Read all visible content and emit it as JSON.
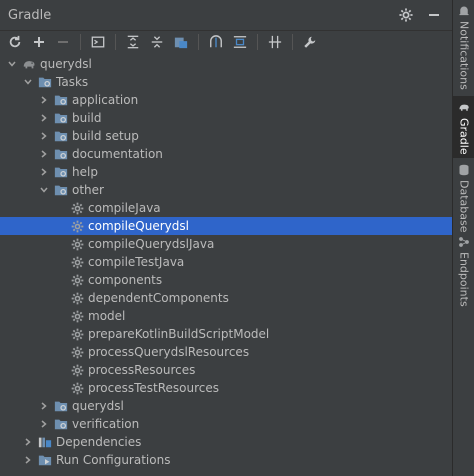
{
  "panel": {
    "title": "Gradle"
  },
  "toolbar": {
    "tools": [
      "reload-icon",
      "add-icon",
      "remove-icon",
      "execute-task-icon",
      "expand-all-icon",
      "collapse-all-icon",
      "dependencies-icon",
      "analyze-icon",
      "toggle-offline-icon",
      "show-diagram-icon",
      "settings-wrench-icon"
    ]
  },
  "tree": {
    "root": "querydsl",
    "tasks": "Tasks",
    "groups": [
      "application",
      "build",
      "build setup",
      "documentation",
      "help"
    ],
    "other": "other",
    "other_items": [
      "compileJava",
      "compileQuerydsl",
      "compileQuerydslJava",
      "compileTestJava",
      "components",
      "dependentComponents",
      "model",
      "prepareKotlinBuildScriptModel",
      "processQuerydslResources",
      "processResources",
      "processTestResources"
    ],
    "selected_index": 1,
    "after_groups": [
      "querydsl",
      "verification"
    ],
    "dependencies": "Dependencies",
    "run_configurations": "Run Configurations"
  },
  "sidebar": {
    "tabs": [
      "Notifications",
      "Gradle",
      "Database",
      "Endpoints"
    ],
    "active": "Gradle"
  },
  "colors": {
    "selection": "#2f65ca",
    "background": "#3c3f41",
    "folder": "#6e8fb0",
    "gear": "#9da0a2"
  }
}
